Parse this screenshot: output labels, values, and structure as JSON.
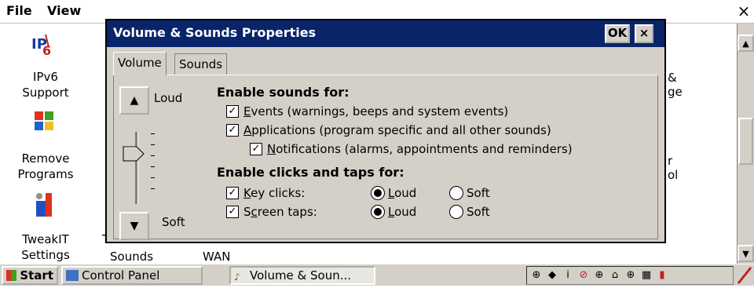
{
  "menu": {
    "file": "File",
    "view": "View",
    "close": "×"
  },
  "desktop_items": [
    {
      "label1": "IPv6",
      "label2": "Support"
    },
    {
      "label1": "Remove",
      "label2": "Programs"
    },
    {
      "label1": "TweakIT",
      "label2": "Settings"
    }
  ],
  "background_fragments": {
    "sounds": "Sounds",
    "wan": "WAN",
    "amp": "&",
    "ge": "ge",
    "r": "r",
    "ol": "ol",
    "partial_t": "T"
  },
  "dialog": {
    "title": "Volume & Sounds Properties",
    "ok": "OK",
    "close": "×",
    "tabs": [
      {
        "label": "Volume"
      },
      {
        "label": "Sounds"
      }
    ],
    "loud_label": "Loud",
    "soft_label": "Soft",
    "enable_sounds_heading": "Enable sounds for:",
    "events": {
      "label_u": "E",
      "label_rest": "vents (warnings, beeps and system events)",
      "checked": true
    },
    "applications": {
      "label_u": "A",
      "label_rest": "pplications (program specific and all other sounds)",
      "checked": true
    },
    "notifications": {
      "label_u": "N",
      "label_rest": "otifications (alarms, appointments and reminders)",
      "checked": true
    },
    "enable_clicks_heading": "Enable clicks and taps for:",
    "key_clicks": {
      "label_u": "K",
      "label_rest": "ey clicks:",
      "checked": true,
      "loud_u": "L",
      "loud_rest": "oud",
      "soft_label": "Soft",
      "selected": "Loud"
    },
    "screen_taps": {
      "label_pre": "S",
      "label_u": "c",
      "label_rest": "reen taps:",
      "checked": true,
      "loud_u": "L",
      "loud_rest": "oud",
      "soft_label": "Soft",
      "selected": "Loud"
    },
    "volume_level": 0.7
  },
  "taskbar": {
    "start": "Start",
    "control_panel": "Control Panel",
    "active_task": "Volume & Soun..."
  },
  "colors": {
    "title_bar": "#0a246a",
    "face": "#d4d0c8"
  }
}
